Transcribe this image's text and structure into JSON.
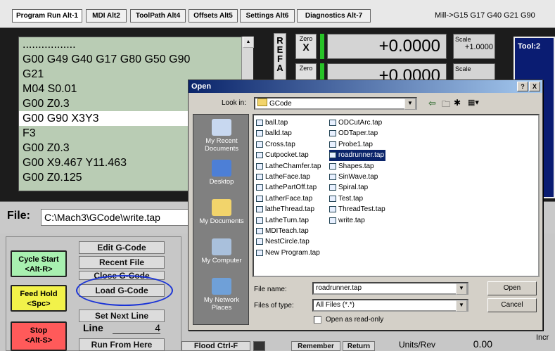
{
  "tabs": [
    {
      "label": "Program Run Alt-1"
    },
    {
      "label": "MDI Alt2"
    },
    {
      "label": "ToolPath Alt4"
    },
    {
      "label": "Offsets Alt5"
    },
    {
      "label": "Settings Alt6"
    },
    {
      "label": "Diagnostics Alt-7"
    }
  ],
  "modal_line": "Mill->G15  G17 G40 G21 G90",
  "gcode_lines": [
    ".................",
    "G00 G49 G40  G17 G80 G50 G90",
    "G21",
    "M04 S0.01",
    "G00 Z0.3",
    "G00 G90 X3Y3",
    "F3",
    "G00 Z0.3",
    "G00 X9.467 Y11.463",
    "G00 Z0.125"
  ],
  "file_label": "File:",
  "file_path": "C:\\Mach3\\GCode\\write.tap",
  "dro": {
    "axis_x": "REF",
    "zero1": "Zero",
    "axis1": "X",
    "value1": "+0.0000",
    "scale1_label": "Scale",
    "scale1_value": "+1.0000",
    "zero2": "Zero",
    "value2": "+0.0000",
    "scale2_label": "Scale"
  },
  "tool_label": "Tool:2",
  "buttons": {
    "cycle_start": "Cycle Start\n<Alt-R>",
    "feed_hold": "Feed Hold\n<Spc>",
    "stop": "Stop\n<Alt-S>",
    "edit_gcode": "Edit G-Code",
    "recent_file": "Recent File",
    "close_gcode": "Close G-Code",
    "load_gcode": "Load G-Code",
    "set_next_line": "Set Next Line",
    "line_label": "Line",
    "line_value": "4",
    "run_from_here": "Run From Here",
    "flood": "Flood Ctrl-F",
    "remember": "Remember",
    "return": "Return",
    "units_rev": "Units/Rev",
    "units_rev_value": "0.00",
    "incr": "Incr"
  },
  "dialog": {
    "title": "Open",
    "help_btn": "?",
    "close_btn": "X",
    "look_in_label": "Look in:",
    "look_in_value": "GCode",
    "places": [
      {
        "label": "My Recent\nDocuments",
        "icon": "recent-docs-icon"
      },
      {
        "label": "Desktop",
        "icon": "desktop-icon"
      },
      {
        "label": "My Documents",
        "icon": "my-documents-icon"
      },
      {
        "label": "My Computer",
        "icon": "my-computer-icon"
      },
      {
        "label": "My Network\nPlaces",
        "icon": "network-places-icon"
      }
    ],
    "files_col1": [
      "ball.tap",
      "balld.tap",
      "Cross.tap",
      "Cutpocket.tap",
      "LatheChamfer.tap",
      "LatheFace.tap",
      "LathePartOff.tap",
      "LatherFace.tap",
      "latheThread.tap",
      "LatheTurn.tap",
      "MDITeach.tap",
      "NestCircle.tap",
      "New Program.tap"
    ],
    "files_col2": [
      "ODCutArc.tap",
      "ODTaper.tap",
      "Probe1.tap",
      "roadrunner.tap",
      "Shapes.tap",
      "SinWave.tap",
      "Spiral.tap",
      "Test.tap",
      "ThreadTest.tap",
      "write.tap"
    ],
    "selected_file": "roadrunner.tap",
    "file_name_label": "File name:",
    "file_name_value": "roadrunner.tap",
    "files_type_label": "Files of type:",
    "files_type_value": "All Files (*.*)",
    "read_only_label": "Open as read-only",
    "open_btn": "Open",
    "cancel_btn": "Cancel"
  },
  "colors": {
    "cycle_start": "#a8f0b0",
    "feed_hold": "#f2f24a",
    "stop": "#ff5a5a",
    "annotation": "#1a33d6",
    "titlebar": "#0a246a"
  }
}
